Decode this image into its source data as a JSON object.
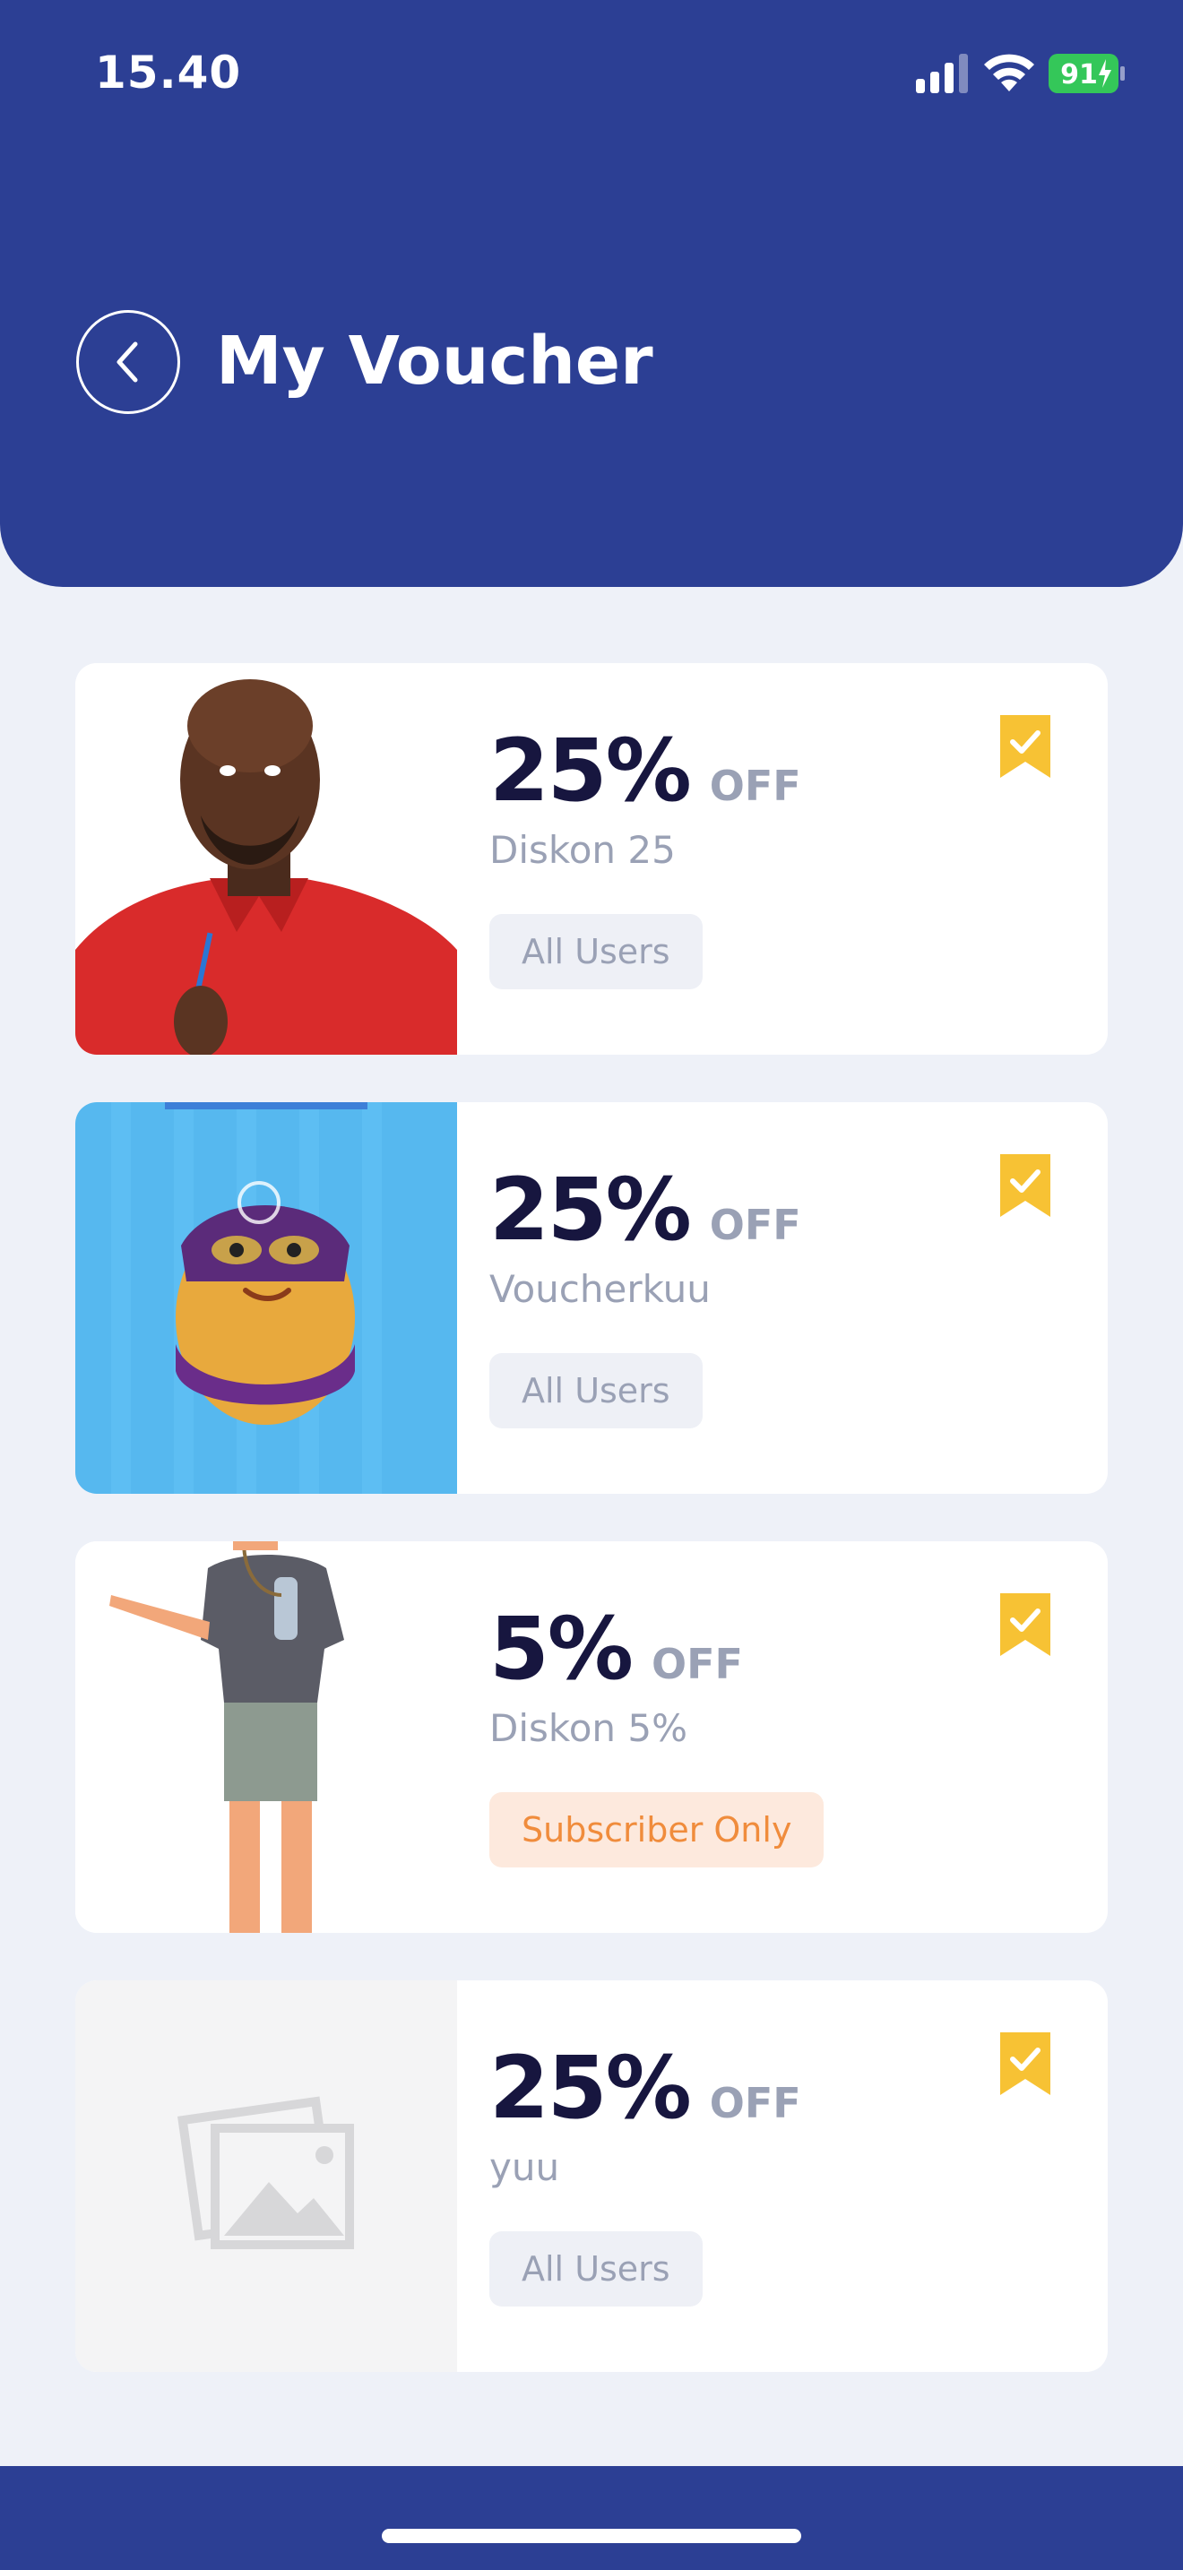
{
  "status_bar": {
    "time": "15.40",
    "battery": "91"
  },
  "header": {
    "title": "My Voucher",
    "background": "#2c3f94"
  },
  "vouchers": [
    {
      "discount": "25%",
      "off_label": "OFF",
      "name": "Diskon 25",
      "tag": "All Users",
      "image": "man-thinking-photo"
    },
    {
      "discount": "25%",
      "off_label": "OFF",
      "name": "Voucherkuu",
      "tag": "All Users",
      "image": "cartoon-egg-character"
    },
    {
      "discount": "5%",
      "off_label": "OFF",
      "name": "Diskon 5%",
      "tag": "Subscriber Only",
      "image": "pointing-man-illustration"
    },
    {
      "discount": "25%",
      "off_label": "OFF",
      "name": "yuu",
      "tag": "All Users",
      "image": "image-placeholder-icon"
    }
  ],
  "colors": {
    "accent": "#2c3f94",
    "bookmark": "#f7c234",
    "discount_text": "#17163f",
    "muted_text": "#9aa1b5",
    "subscriber_tag_bg": "#fde9dd",
    "subscriber_tag_text": "#f08c3c"
  }
}
